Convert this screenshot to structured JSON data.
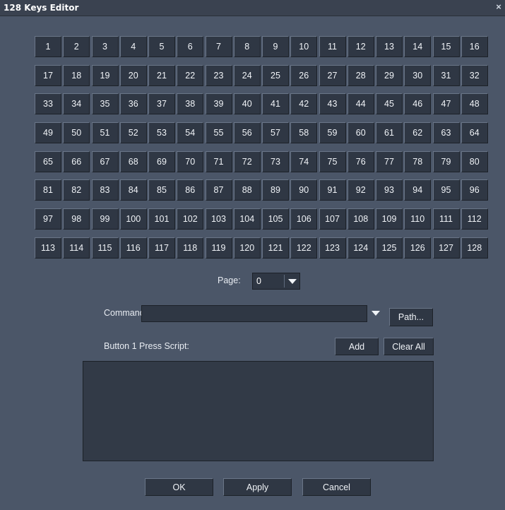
{
  "window": {
    "title": "128 Keys Editor",
    "close_glyph": "×"
  },
  "keys": [
    "1",
    "2",
    "3",
    "4",
    "5",
    "6",
    "7",
    "8",
    "9",
    "10",
    "11",
    "12",
    "13",
    "14",
    "15",
    "16",
    "17",
    "18",
    "19",
    "20",
    "21",
    "22",
    "23",
    "24",
    "25",
    "26",
    "27",
    "28",
    "29",
    "30",
    "31",
    "32",
    "33",
    "34",
    "35",
    "36",
    "37",
    "38",
    "39",
    "40",
    "41",
    "42",
    "43",
    "44",
    "45",
    "46",
    "47",
    "48",
    "49",
    "50",
    "51",
    "52",
    "53",
    "54",
    "55",
    "56",
    "57",
    "58",
    "59",
    "60",
    "61",
    "62",
    "63",
    "64",
    "65",
    "66",
    "67",
    "68",
    "69",
    "70",
    "71",
    "72",
    "73",
    "74",
    "75",
    "76",
    "77",
    "78",
    "79",
    "80",
    "81",
    "82",
    "83",
    "84",
    "85",
    "86",
    "87",
    "88",
    "89",
    "90",
    "91",
    "92",
    "93",
    "94",
    "95",
    "96",
    "97",
    "98",
    "99",
    "100",
    "101",
    "102",
    "103",
    "104",
    "105",
    "106",
    "107",
    "108",
    "109",
    "110",
    "111",
    "112",
    "113",
    "114",
    "115",
    "116",
    "117",
    "118",
    "119",
    "120",
    "121",
    "122",
    "123",
    "124",
    "125",
    "126",
    "127",
    "128"
  ],
  "page": {
    "label": "Page:",
    "value": "0"
  },
  "command": {
    "label": "Command:",
    "value": "",
    "path_button": "Path..."
  },
  "script": {
    "label": "Button 1 Press Script:",
    "add_button": "Add",
    "clear_button": "Clear All",
    "content": ""
  },
  "footer": {
    "ok": "OK",
    "apply": "Apply",
    "cancel": "Cancel"
  },
  "colors": {
    "background": "#4b5668",
    "button": "#2f3744",
    "titlebar": "#3a4250"
  }
}
